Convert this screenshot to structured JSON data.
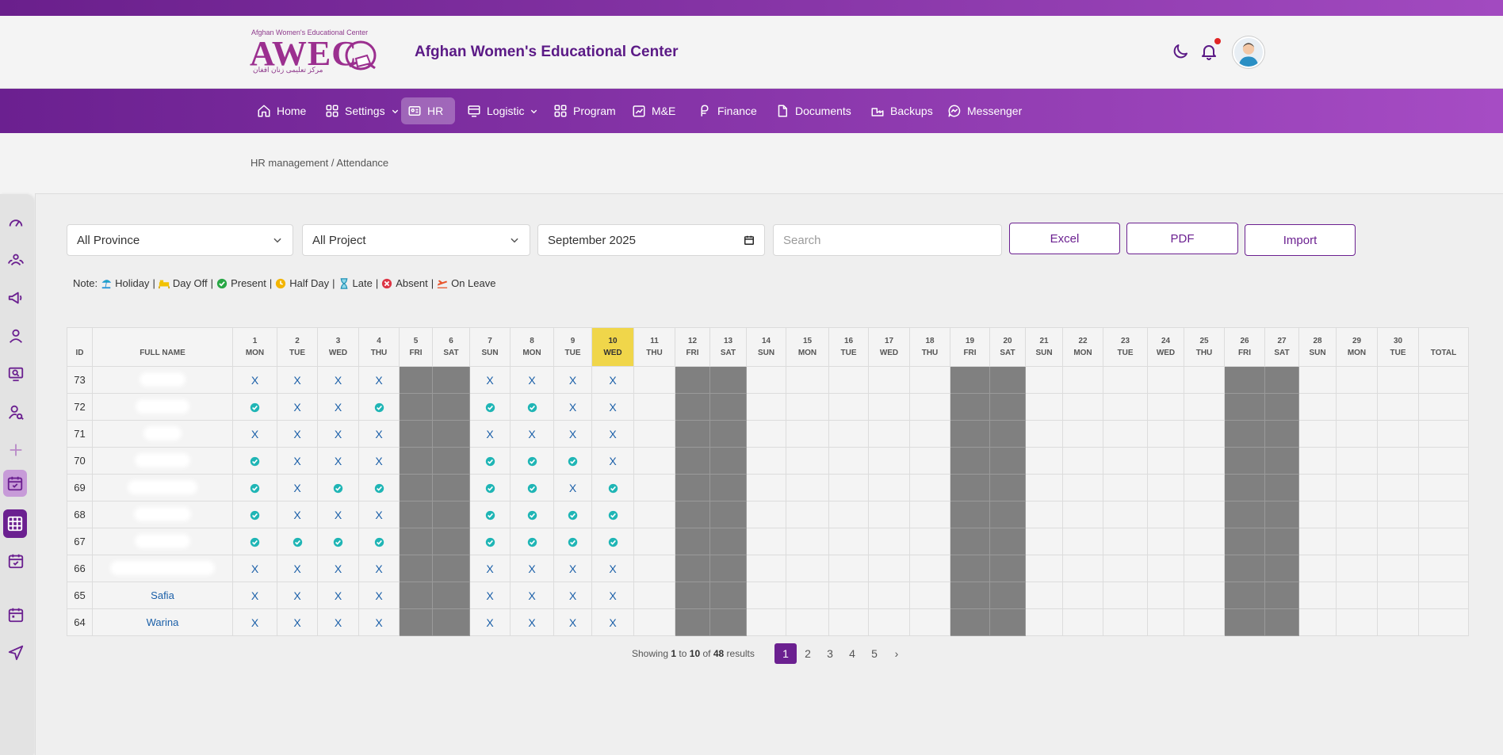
{
  "header": {
    "logo_small": "Afghan Women's Educational Center",
    "logo_big": "AWEC",
    "logo_arabic": "مرکز تعلیمی زنان افغان",
    "title": "Afghan Women's Educational Center",
    "icons": [
      "moon-icon",
      "bell-icon",
      "user-avatar"
    ]
  },
  "nav": [
    {
      "label": "Home",
      "icon": "home-icon"
    },
    {
      "label": "Settings",
      "icon": "grid-icon",
      "dropdown": true
    },
    {
      "label": "HR",
      "icon": "id-card-icon",
      "active": true
    },
    {
      "label": "Logistic",
      "icon": "monitor-icon",
      "dropdown": true
    },
    {
      "label": "Program",
      "icon": "grid-icon"
    },
    {
      "label": "M&E",
      "icon": "chart-icon"
    },
    {
      "label": "Finance",
      "icon": "finance-icon"
    },
    {
      "label": "Documents",
      "icon": "document-icon"
    },
    {
      "label": "Backups",
      "icon": "backup-icon"
    },
    {
      "label": "Messenger",
      "icon": "chat-icon"
    }
  ],
  "breadcrumb": "HR management / Attendance",
  "filters": {
    "province": "All Province",
    "project": "All Project",
    "month": "September 2025",
    "search_placeholder": "Search"
  },
  "buttons": {
    "excel": "Excel",
    "pdf": "PDF",
    "import": "Import"
  },
  "legend": {
    "prefix": "Note:",
    "items": [
      "Holiday",
      "Day Off",
      "Present",
      "Half Day",
      "Late",
      "Absent",
      "On Leave"
    ]
  },
  "table": {
    "id_header": "ID",
    "name_header": "FULL NAME",
    "total_header": "TOTAL",
    "today": 10,
    "days": [
      {
        "d": "1",
        "w": "MON"
      },
      {
        "d": "2",
        "w": "TUE"
      },
      {
        "d": "3",
        "w": "WED"
      },
      {
        "d": "4",
        "w": "THU"
      },
      {
        "d": "5",
        "w": "FRI",
        "off": true
      },
      {
        "d": "6",
        "w": "SAT",
        "off": true
      },
      {
        "d": "7",
        "w": "SUN"
      },
      {
        "d": "8",
        "w": "MON"
      },
      {
        "d": "9",
        "w": "TUE"
      },
      {
        "d": "10",
        "w": "WED"
      },
      {
        "d": "11",
        "w": "THU"
      },
      {
        "d": "12",
        "w": "FRI",
        "off": true
      },
      {
        "d": "13",
        "w": "SAT",
        "off": true
      },
      {
        "d": "14",
        "w": "SUN"
      },
      {
        "d": "15",
        "w": "MON"
      },
      {
        "d": "16",
        "w": "TUE"
      },
      {
        "d": "17",
        "w": "WED"
      },
      {
        "d": "18",
        "w": "THU"
      },
      {
        "d": "19",
        "w": "FRI",
        "off": true
      },
      {
        "d": "20",
        "w": "SAT",
        "off": true
      },
      {
        "d": "21",
        "w": "SUN"
      },
      {
        "d": "22",
        "w": "MON"
      },
      {
        "d": "23",
        "w": "TUE"
      },
      {
        "d": "24",
        "w": "WED"
      },
      {
        "d": "25",
        "w": "THU"
      },
      {
        "d": "26",
        "w": "FRI",
        "off": true
      },
      {
        "d": "27",
        "w": "SAT",
        "off": true
      },
      {
        "d": "28",
        "w": "SUN"
      },
      {
        "d": "29",
        "w": "MON"
      },
      {
        "d": "30",
        "w": "TUE"
      }
    ],
    "rows": [
      {
        "id": "73",
        "name": "",
        "marks": [
          "X",
          "X",
          "X",
          "X",
          "X",
          "X",
          "X",
          "X"
        ]
      },
      {
        "id": "72",
        "name": "",
        "marks": [
          "P",
          "X",
          "X",
          "P",
          "P",
          "P",
          "X",
          "X"
        ]
      },
      {
        "id": "71",
        "name": "",
        "marks": [
          "X",
          "X",
          "X",
          "X",
          "X",
          "X",
          "X",
          "X"
        ]
      },
      {
        "id": "70",
        "name": "",
        "marks": [
          "P",
          "X",
          "X",
          "X",
          "P",
          "P",
          "P",
          "X"
        ]
      },
      {
        "id": "69",
        "name": "",
        "marks": [
          "P",
          "X",
          "P",
          "P",
          "P",
          "P",
          "X",
          "P"
        ]
      },
      {
        "id": "68",
        "name": "",
        "marks": [
          "P",
          "X",
          "X",
          "X",
          "P",
          "P",
          "P",
          "P"
        ]
      },
      {
        "id": "67",
        "name": "",
        "marks": [
          "P",
          "P",
          "P",
          "P",
          "P",
          "P",
          "P",
          "P"
        ]
      },
      {
        "id": "66",
        "name": "",
        "marks": [
          "X",
          "X",
          "X",
          "X",
          "X",
          "X",
          "X",
          "X"
        ]
      },
      {
        "id": "65",
        "name": "Safia",
        "marks": [
          "X",
          "X",
          "X",
          "X",
          "X",
          "X",
          "X",
          "X"
        ]
      },
      {
        "id": "64",
        "name": "Warina",
        "marks": [
          "X",
          "X",
          "X",
          "X",
          "X",
          "X",
          "X",
          "X"
        ]
      }
    ]
  },
  "pagination": {
    "showing": "Showing",
    "from": "1",
    "to_word": "to",
    "to": "10",
    "of_word": "of",
    "total": "48",
    "results": "results",
    "pages": [
      "1",
      "2",
      "3",
      "4",
      "5"
    ],
    "next": "›"
  },
  "colors": {
    "brand": "#6b2090",
    "present": "#1fb5b5",
    "today": "#f0d64a",
    "off": "#808080"
  }
}
